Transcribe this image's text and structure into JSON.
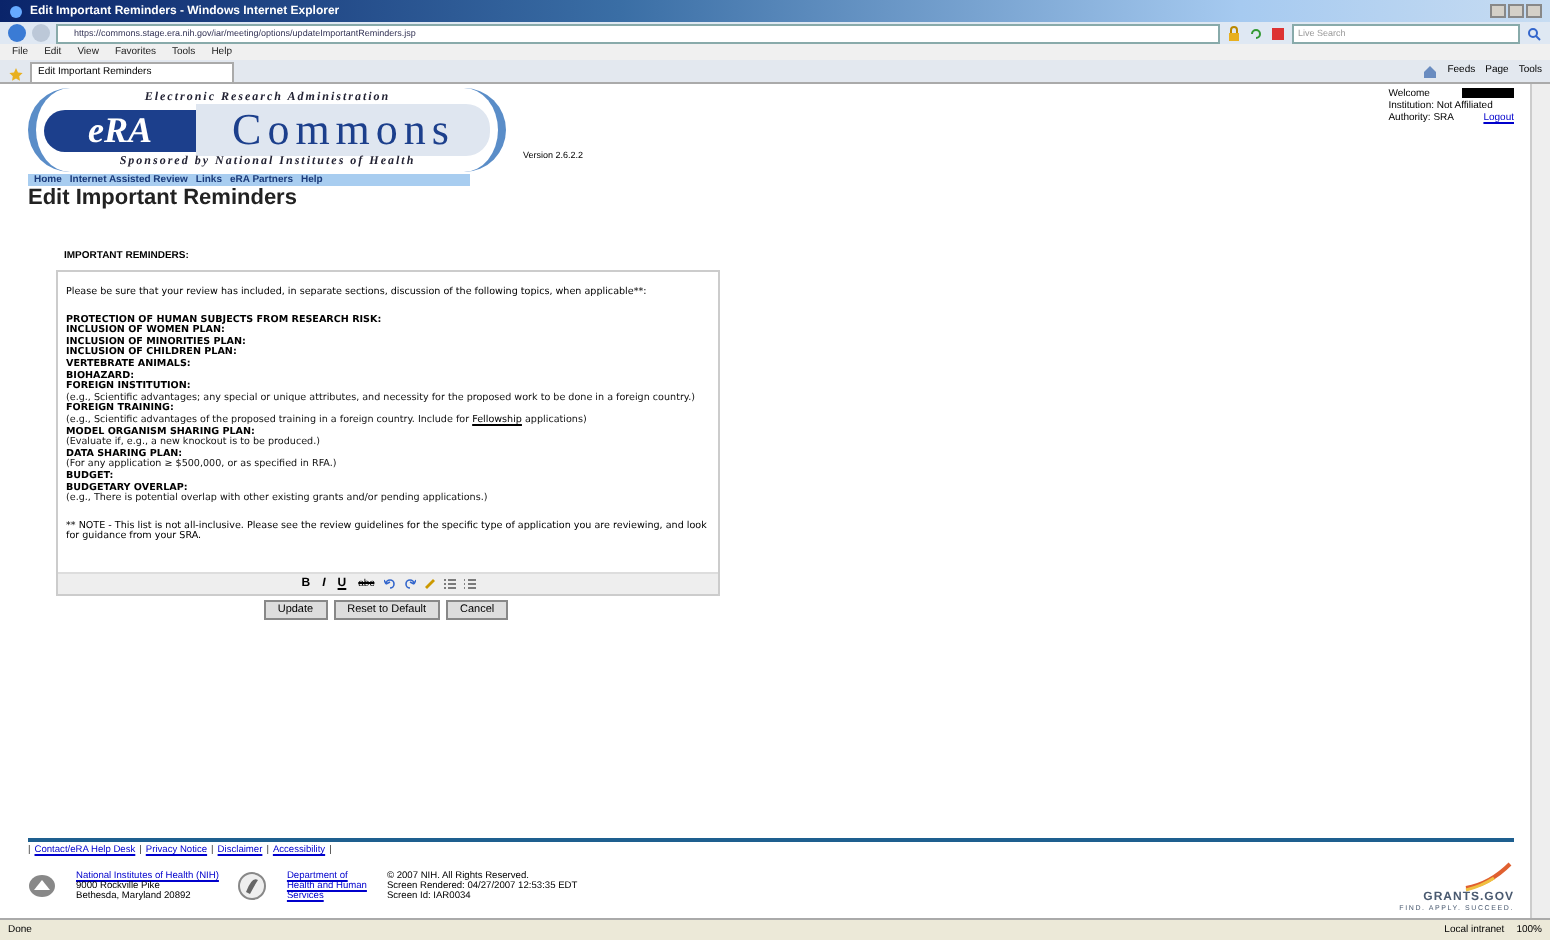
{
  "window": {
    "title": "Edit Important Reminders - Windows Internet Explorer"
  },
  "address_bar": {
    "url": "https://commons.stage.era.nih.gov/iar/meeting/options/updateImportantReminders.jsp",
    "search_placeholder": "Live Search"
  },
  "menu": [
    "File",
    "Edit",
    "View",
    "Favorites",
    "Tools",
    "Help"
  ],
  "tabs": [
    {
      "label": "Edit Important Reminders",
      "selected": true
    }
  ],
  "command_bar": [
    "Feeds",
    "Page",
    "Tools"
  ],
  "logo": {
    "top": "Electronic Research Administration",
    "badge": "eRA",
    "name": "Commons",
    "bottom": "Sponsored by National Institutes of Health"
  },
  "version": "Version 2.6.2.2",
  "user": {
    "welcome": "Welcome",
    "institution": "Institution: Not Affiliated",
    "authority": "Authority:  SRA",
    "logout": "Logout"
  },
  "nav": [
    "Home",
    "Internet Assisted Review",
    "Links",
    "eRA Partners",
    "Help"
  ],
  "heading": "Edit Important Reminders",
  "section_label": "IMPORTANT REMINDERS:",
  "editor": {
    "paragraphs": [
      {
        "kind": "intro",
        "text": "Please be sure that your review has included, in separate sections, discussion of the following topics, when applicable**:"
      },
      {
        "kind": "heading",
        "text": "PROTECTION OF HUMAN SUBJECTS FROM RESEARCH RISK:"
      },
      {
        "kind": "heading",
        "text": "INCLUSION OF WOMEN PLAN:"
      },
      {
        "kind": "heading",
        "text": "INCLUSION OF MINORITIES PLAN:"
      },
      {
        "kind": "heading",
        "text": "INCLUSION OF CHILDREN PLAN:"
      },
      {
        "kind": "heading",
        "text": "VERTEBRATE ANIMALS:"
      },
      {
        "kind": "heading",
        "text": "BIOHAZARD:"
      },
      {
        "kind": "heading",
        "text": "FOREIGN INSTITUTION:"
      },
      {
        "kind": "detail",
        "text": "(e.g., Scientific advantages; any special or unique attributes, and necessity for the proposed work to be done in a foreign country.)"
      },
      {
        "kind": "heading",
        "text": "FOREIGN TRAINING:"
      },
      {
        "kind": "detail",
        "text": "(e.g., Scientific advantages of the proposed training in a foreign country. Include for ",
        "link": "Fellowship",
        "after": " applications)"
      },
      {
        "kind": "heading",
        "text": "MODEL ORGANISM SHARING PLAN:"
      },
      {
        "kind": "detail",
        "text": "(Evaluate if, e.g., a new knockout is to be produced.)"
      },
      {
        "kind": "heading",
        "text": "DATA SHARING PLAN:"
      },
      {
        "kind": "detail",
        "text": "(For any application ≥ $500,000, or as specified in RFA.)"
      },
      {
        "kind": "heading",
        "text": "BUDGET:"
      },
      {
        "kind": "heading",
        "text": "BUDGETARY OVERLAP:"
      },
      {
        "kind": "detail",
        "text": "(e.g., There is potential overlap with other existing grants and/or pending applications.)"
      },
      {
        "kind": "note",
        "text": "** NOTE - This list is not all-inclusive. Please see the review guidelines for the specific type of application you are reviewing, and look for guidance from your SRA."
      }
    ],
    "toolbar": [
      {
        "kind": "bold",
        "label": "B"
      },
      {
        "kind": "italic",
        "label": "I"
      },
      {
        "kind": "underline",
        "label": "U"
      },
      {
        "kind": "strike",
        "label": "abc"
      },
      {
        "kind": "undo"
      },
      {
        "kind": "redo"
      },
      {
        "kind": "pencil"
      },
      {
        "kind": "bullets"
      },
      {
        "kind": "numbers"
      }
    ]
  },
  "buttons": [
    "Update",
    "Reset to Default",
    "Cancel"
  ],
  "footer": {
    "links": [
      {
        "kind": "separator",
        "text": "|"
      },
      {
        "kind": "link",
        "text": "Contact/eRA Help Desk"
      },
      {
        "kind": "separator",
        "text": "|"
      },
      {
        "kind": "link",
        "text": "Privacy Notice"
      },
      {
        "kind": "separator",
        "text": "|"
      },
      {
        "kind": "link",
        "text": "Disclaimer"
      },
      {
        "kind": "separator",
        "text": "|"
      },
      {
        "kind": "link",
        "text": "Accessibility"
      },
      {
        "kind": "separator",
        "text": "|"
      }
    ],
    "nih": {
      "link": "National Institutes of Health (NIH)",
      "address": [
        "9000 Rockville Pike",
        "Bethesda, Maryland 20892"
      ]
    },
    "hhs": {
      "link": "Department of Health and Human Services"
    },
    "info": [
      "© 2007 NIH. All Rights Reserved.",
      "Screen Rendered: 04/27/2007 12:53:35 EDT",
      "Screen Id: IAR0034"
    ],
    "grants": {
      "name": "GRANTS.GOV",
      "tagline": "FIND. APPLY. SUCCEED."
    }
  },
  "status_bar": {
    "text": "Done",
    "zone": "Local intranet",
    "zoom": "100%"
  }
}
